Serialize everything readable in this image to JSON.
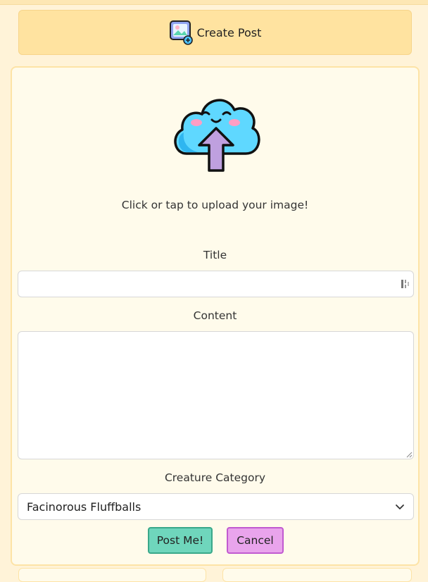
{
  "header": {
    "icon": "image-add-icon",
    "label": "Create Post"
  },
  "upload": {
    "icon": "cloud-upload-icon",
    "hint": "Click or tap to upload your image!"
  },
  "form": {
    "title_label": "Title",
    "title_value": "",
    "content_label": "Content",
    "content_value": "",
    "category_label": "Creature Category",
    "category_value": "Facinorous Fluffballs"
  },
  "actions": {
    "post_label": "Post Me!",
    "cancel_label": "Cancel"
  },
  "colors": {
    "page_bg": "#fff3d8",
    "header_bg": "#ffe3a0",
    "card_bg": "#fffbeb",
    "post_button": "#6fd6bc",
    "cancel_button": "#e9a4ec"
  }
}
